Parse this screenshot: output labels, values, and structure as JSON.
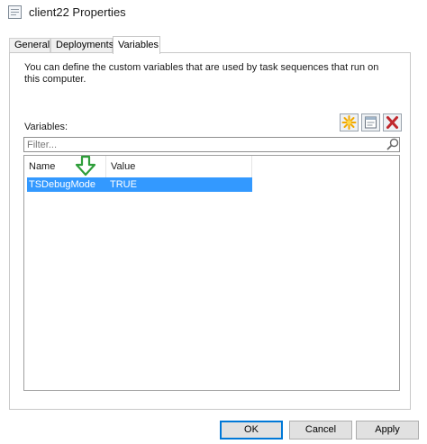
{
  "window": {
    "title": "client22 Properties"
  },
  "tabs": [
    {
      "label": "General"
    },
    {
      "label": "Deployments"
    },
    {
      "label": "Variables"
    }
  ],
  "active_tab": "Variables",
  "panel": {
    "description": "You can define the custom variables that are used by task sequences that run on this computer.",
    "variables_label": "Variables:"
  },
  "toolbar": {
    "new_icon": "new-star-icon",
    "properties_icon": "properties-icon",
    "delete_icon": "delete-x-icon"
  },
  "filter": {
    "placeholder": "Filter..."
  },
  "table": {
    "columns": [
      "Name",
      "Value"
    ],
    "rows": [
      {
        "name": "TSDebugMode",
        "value": "TRUE",
        "selected": true
      }
    ]
  },
  "buttons": {
    "ok": "OK",
    "cancel": "Cancel",
    "apply": "Apply"
  },
  "colors": {
    "selection": "#3399ff",
    "arrow": "#2e9e3a",
    "delete": "#c0282d",
    "star": "#f2a900"
  }
}
